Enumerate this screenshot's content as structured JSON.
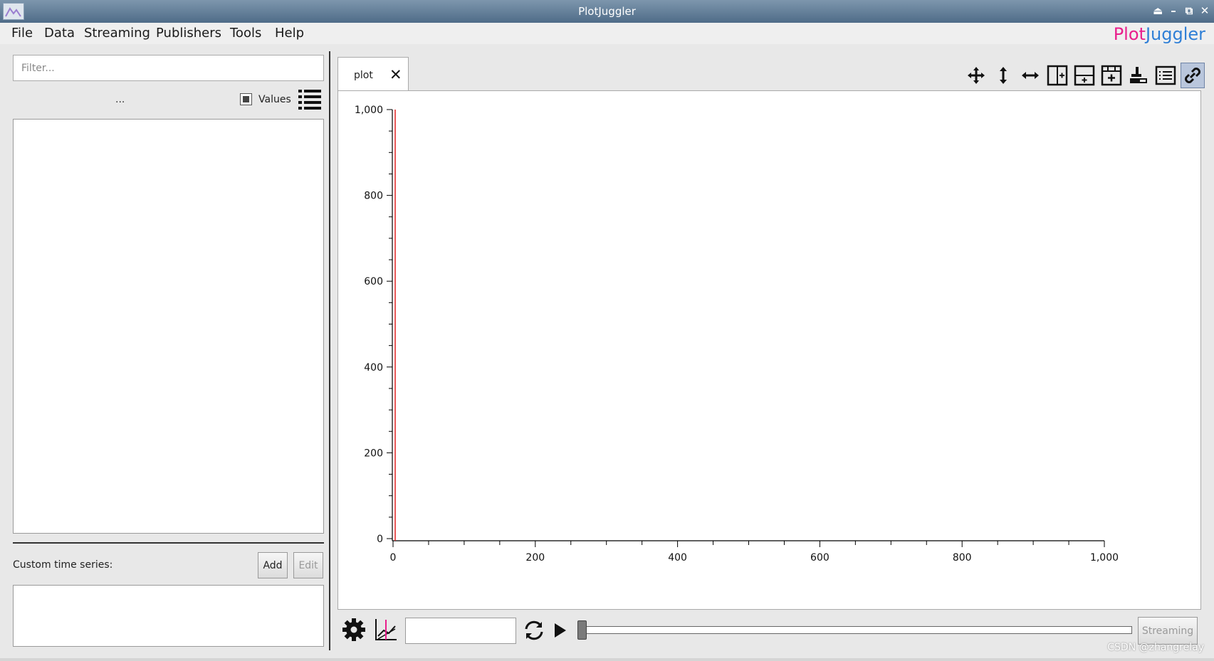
{
  "window": {
    "title": "PlotJuggler"
  },
  "menu": {
    "items": [
      "File",
      "Data",
      "Streaming",
      "Publishers",
      "Tools",
      "Help"
    ]
  },
  "brand": {
    "part1": "Plot",
    "part2": "Juggler",
    "color1": "#e91e8c",
    "color2": "#2f7fd6"
  },
  "sidebar": {
    "filter_placeholder": "Filter...",
    "ellipsis": "...",
    "values_label": "Values",
    "values_checked": true,
    "custom_label": "Custom time series:",
    "add_label": "Add",
    "edit_label": "Edit"
  },
  "tab": {
    "label": "plot"
  },
  "toolbar": {
    "icons": [
      "move-icon",
      "zoom-vertical-icon",
      "zoom-horizontal-icon",
      "split-horizontal-icon",
      "split-vertical-icon",
      "add-plot-icon",
      "clear-icon",
      "legend-icon",
      "link-icon"
    ]
  },
  "chart_data": {
    "type": "line",
    "title": "",
    "xlabel": "",
    "ylabel": "",
    "xlim": [
      0,
      1000
    ],
    "ylim": [
      0,
      1000
    ],
    "xticks": [
      0,
      200,
      400,
      600,
      800,
      1000
    ],
    "xtick_labels": [
      "0",
      "200",
      "400",
      "600",
      "800",
      "1,000"
    ],
    "yticks": [
      0,
      200,
      400,
      600,
      800,
      1000
    ],
    "ytick_labels": [
      "0",
      "200",
      "400",
      "600",
      "800",
      "1,000"
    ],
    "series": [],
    "marker_line": {
      "x": 0,
      "color": "#e02020"
    },
    "grid": false
  },
  "bottom": {
    "streaming_label": "Streaming",
    "time_value": ""
  },
  "watermark": "CSDN @zhangrelay"
}
